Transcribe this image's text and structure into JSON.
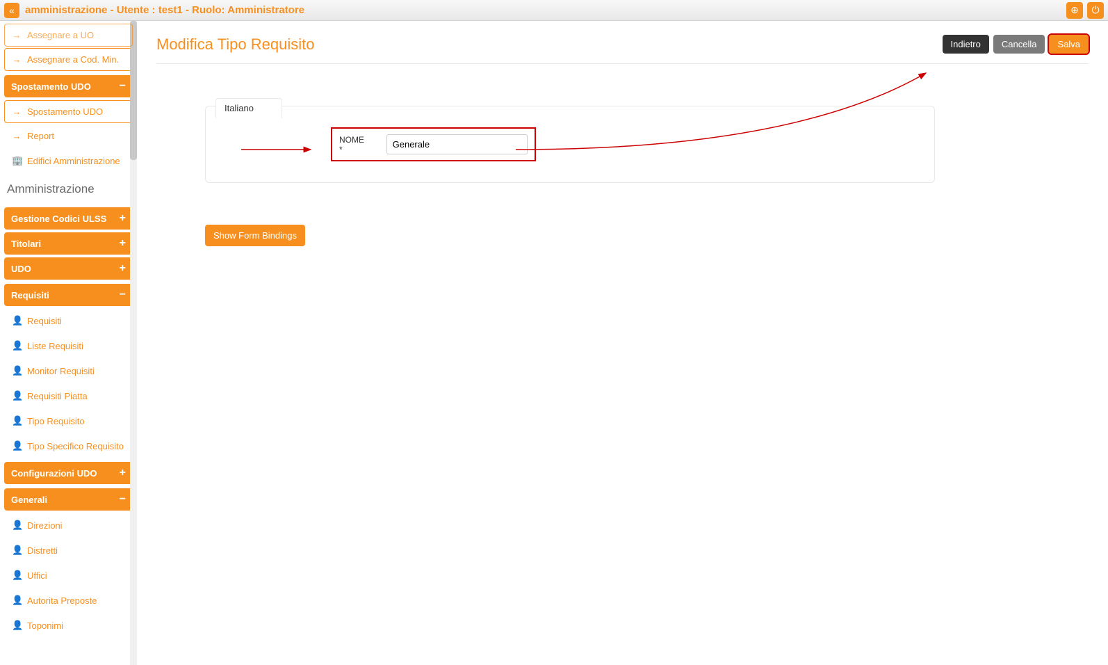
{
  "header": {
    "title": "amministrazione - Utente : test1 - Ruolo: Amministratore"
  },
  "sidebar": {
    "top_items": [
      {
        "label": "Assegnare a UO",
        "icon": "→",
        "boxed": true,
        "faded": true
      },
      {
        "label": "Assegnare a Cod. Min.",
        "icon": "→",
        "boxed": true
      }
    ],
    "section_spostamento": {
      "header": "Spostamento UDO",
      "toggle": "−",
      "items": [
        {
          "label": "Spostamento UDO",
          "icon": "→",
          "boxed": true
        }
      ]
    },
    "mid_items": [
      {
        "label": "Report",
        "icon": "→"
      },
      {
        "label": "Edifici Amministrazione",
        "icon": "🏢"
      }
    ],
    "admin_title": "Amministrazione",
    "section_codici": {
      "header": "Gestione Codici ULSS",
      "toggle": "+"
    },
    "section_titolari": {
      "header": "Titolari",
      "toggle": "+"
    },
    "section_udo": {
      "header": "UDO",
      "toggle": "+"
    },
    "section_requisiti": {
      "header": "Requisiti",
      "toggle": "−",
      "items": [
        {
          "label": "Requisiti"
        },
        {
          "label": "Liste Requisiti"
        },
        {
          "label": "Monitor Requisiti"
        },
        {
          "label": "Requisiti Piatta"
        },
        {
          "label": "Tipo Requisito"
        },
        {
          "label": "Tipo Specifico Requisito"
        }
      ]
    },
    "section_config": {
      "header": "Configurazioni UDO",
      "toggle": "+"
    },
    "section_generali": {
      "header": "Generali",
      "toggle": "−",
      "items": [
        {
          "label": "Direzioni"
        },
        {
          "label": "Distretti"
        },
        {
          "label": "Uffici"
        },
        {
          "label": "Autorita Preposte"
        },
        {
          "label": "Toponimi"
        }
      ]
    }
  },
  "content": {
    "title": "Modifica Tipo Requisito",
    "buttons": {
      "back": "Indietro",
      "cancel": "Cancella",
      "save": "Salva"
    },
    "tab": "Italiano",
    "field_label": "NOME *",
    "field_value": "Generale",
    "show_bindings": "Show Form Bindings"
  }
}
